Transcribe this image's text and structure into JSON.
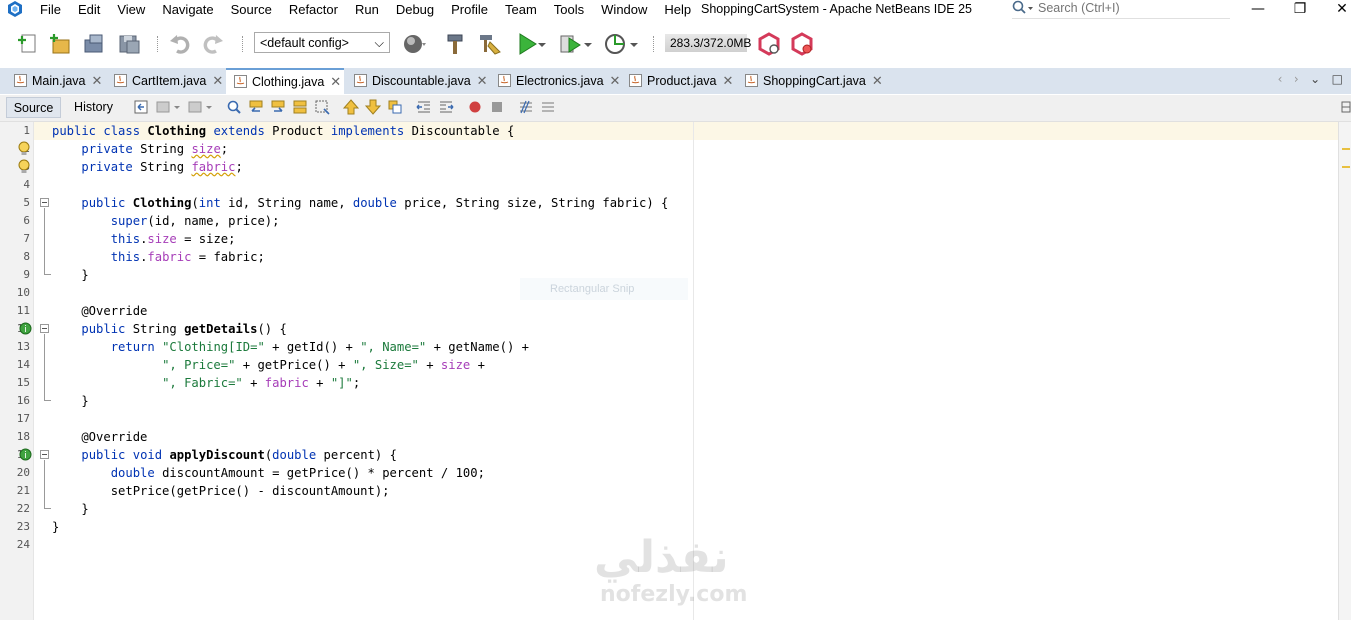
{
  "window": {
    "title": "ShoppingCartSystem - Apache NetBeans IDE 25",
    "search_placeholder": "Search (Ctrl+I)"
  },
  "menu": [
    "File",
    "Edit",
    "View",
    "Navigate",
    "Source",
    "Refactor",
    "Run",
    "Debug",
    "Profile",
    "Team",
    "Tools",
    "Window",
    "Help"
  ],
  "toolbar": {
    "config_value": "<default config>",
    "memory": "283.3/372.0MB"
  },
  "tabs": [
    {
      "label": "Main.java",
      "active": false
    },
    {
      "label": "CartItem.java",
      "active": false
    },
    {
      "label": "Clothing.java",
      "active": true
    },
    {
      "label": "Discountable.java",
      "active": false
    },
    {
      "label": "Electronics.java",
      "active": false
    },
    {
      "label": "Product.java",
      "active": false
    },
    {
      "label": "ShoppingCart.java",
      "active": false
    }
  ],
  "editor_toolbar": {
    "source": "Source",
    "history": "History"
  },
  "line_numbers": [
    "1",
    "2",
    "3",
    "4",
    "5",
    "6",
    "7",
    "8",
    "9",
    "10",
    "11",
    "12",
    "13",
    "14",
    "15",
    "16",
    "17",
    "18",
    "19",
    "20",
    "21",
    "22",
    "23",
    "24"
  ],
  "code": [
    "public class Clothing extends Product implements Discountable {",
    "    private String size;",
    "    private String fabric;",
    "",
    "    public Clothing(int id, String name, double price, String size, String fabric) {",
    "        super(id, name, price);",
    "        this.size = size;",
    "        this.fabric = fabric;",
    "    }",
    "",
    "    @Override",
    "    public String getDetails() {",
    "        return \"Clothing[ID=\" + getId() + \", Name=\" + getName() +",
    "               \", Price=\" + getPrice() + \", Size=\" + size +",
    "               \", Fabric=\" + fabric + \"]\";",
    "    }",
    "",
    "    @Override",
    "    public void applyDiscount(double percent) {",
    "        double discountAmount = getPrice() * percent / 100;",
    "        setPrice(getPrice() - discountAmount);",
    "    }",
    "}",
    ""
  ],
  "overlay": {
    "snip_label": "Rectangular Snip"
  },
  "watermark": {
    "arabic": "نفذلي",
    "latin": "nofezly.com"
  },
  "colors": {
    "keyword": "#0033b3",
    "string": "#1c7a3c",
    "field": "#a63db8",
    "tabbar": "#dae3ee"
  }
}
